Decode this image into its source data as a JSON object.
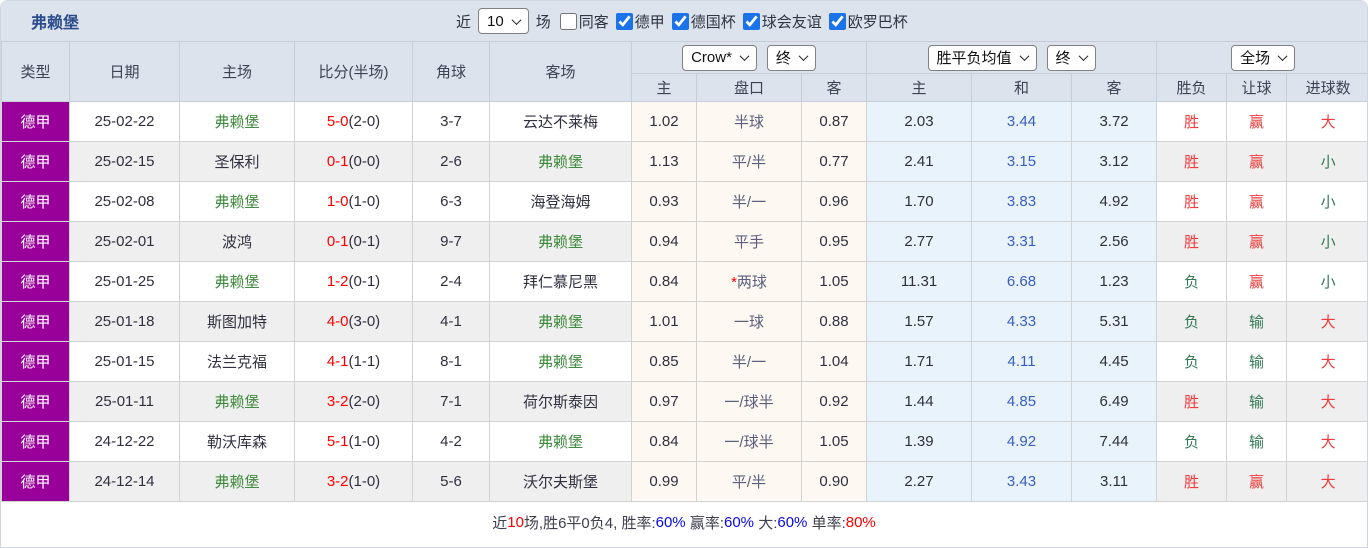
{
  "colors": {
    "league_purple": "#990099",
    "self_team_green": "#3e8a3e",
    "score_red": "#ff0000",
    "result_red": "#ef3b3b",
    "result_green": "#337a55",
    "avg_draw_blue": "#3a5dc0",
    "checkbox_blue": "#1a73e8",
    "header_bg": "#dce3ed"
  },
  "header": {
    "title": "弗赖堡",
    "near_label": "近",
    "near_value": "10",
    "games_label": "场",
    "filters": [
      {
        "label": "同客",
        "checked": false
      },
      {
        "label": "德甲",
        "checked": true
      },
      {
        "label": "德国杯",
        "checked": true
      },
      {
        "label": "球会友谊",
        "checked": true
      },
      {
        "label": "欧罗巴杯",
        "checked": true
      }
    ]
  },
  "table": {
    "columns": {
      "type": "类型",
      "date": "日期",
      "home": "主场",
      "score": "比分(半场)",
      "corners": "角球",
      "away": "客场",
      "odds_home": "主",
      "odds_handicap": "盘口",
      "odds_away": "客",
      "avg_home": "主",
      "avg_draw": "和",
      "avg_away": "客",
      "result_wdl": "胜负",
      "result_handicap": "让球",
      "result_goals": "进球数"
    },
    "selects": {
      "bookmaker": "Crow*",
      "bookmaker_period": "终",
      "average": "胜平负均值",
      "average_period": "终",
      "scope": "全场"
    },
    "rows": [
      {
        "league": "德甲",
        "date": "25-02-22",
        "home": "弗赖堡",
        "home_self": true,
        "score": "5-0",
        "half": "(2-0)",
        "corners": "3-7",
        "away": "云达不莱梅",
        "away_self": false,
        "odds_home": "1.02",
        "handicap": "半球",
        "star": false,
        "odds_away": "0.87",
        "avg_home": "2.03",
        "avg_draw": "3.44",
        "avg_away": "3.72",
        "wdl": "胜",
        "handicap_result": "赢",
        "goals_result": "大"
      },
      {
        "league": "德甲",
        "date": "25-02-15",
        "home": "圣保利",
        "home_self": false,
        "score": "0-1",
        "half": "(0-0)",
        "corners": "2-6",
        "away": "弗赖堡",
        "away_self": true,
        "odds_home": "1.13",
        "handicap": "平/半",
        "star": false,
        "odds_away": "0.77",
        "avg_home": "2.41",
        "avg_draw": "3.15",
        "avg_away": "3.12",
        "wdl": "胜",
        "handicap_result": "赢",
        "goals_result": "小"
      },
      {
        "league": "德甲",
        "date": "25-02-08",
        "home": "弗赖堡",
        "home_self": true,
        "score": "1-0",
        "half": "(1-0)",
        "corners": "6-3",
        "away": "海登海姆",
        "away_self": false,
        "odds_home": "0.93",
        "handicap": "半/一",
        "star": false,
        "odds_away": "0.96",
        "avg_home": "1.70",
        "avg_draw": "3.83",
        "avg_away": "4.92",
        "wdl": "胜",
        "handicap_result": "赢",
        "goals_result": "小"
      },
      {
        "league": "德甲",
        "date": "25-02-01",
        "home": "波鸿",
        "home_self": false,
        "score": "0-1",
        "half": "(0-1)",
        "corners": "9-7",
        "away": "弗赖堡",
        "away_self": true,
        "odds_home": "0.94",
        "handicap": "平手",
        "star": false,
        "odds_away": "0.95",
        "avg_home": "2.77",
        "avg_draw": "3.31",
        "avg_away": "2.56",
        "wdl": "胜",
        "handicap_result": "赢",
        "goals_result": "小"
      },
      {
        "league": "德甲",
        "date": "25-01-25",
        "home": "弗赖堡",
        "home_self": true,
        "score": "1-2",
        "half": "(0-1)",
        "corners": "2-4",
        "away": "拜仁慕尼黑",
        "away_self": false,
        "odds_home": "0.84",
        "handicap": "两球",
        "star": true,
        "odds_away": "1.05",
        "avg_home": "11.31",
        "avg_draw": "6.68",
        "avg_away": "1.23",
        "wdl": "负",
        "handicap_result": "赢",
        "goals_result": "小"
      },
      {
        "league": "德甲",
        "date": "25-01-18",
        "home": "斯图加特",
        "home_self": false,
        "score": "4-0",
        "half": "(3-0)",
        "corners": "4-1",
        "away": "弗赖堡",
        "away_self": true,
        "odds_home": "1.01",
        "handicap": "一球",
        "star": false,
        "odds_away": "0.88",
        "avg_home": "1.57",
        "avg_draw": "4.33",
        "avg_away": "5.31",
        "wdl": "负",
        "handicap_result": "输",
        "goals_result": "大"
      },
      {
        "league": "德甲",
        "date": "25-01-15",
        "home": "法兰克福",
        "home_self": false,
        "score": "4-1",
        "half": "(1-1)",
        "corners": "8-1",
        "away": "弗赖堡",
        "away_self": true,
        "odds_home": "0.85",
        "handicap": "半/一",
        "star": false,
        "odds_away": "1.04",
        "avg_home": "1.71",
        "avg_draw": "4.11",
        "avg_away": "4.45",
        "wdl": "负",
        "handicap_result": "输",
        "goals_result": "大"
      },
      {
        "league": "德甲",
        "date": "25-01-11",
        "home": "弗赖堡",
        "home_self": true,
        "score": "3-2",
        "half": "(2-0)",
        "corners": "7-1",
        "away": "荷尔斯泰因",
        "away_self": false,
        "odds_home": "0.97",
        "handicap": "一/球半",
        "star": false,
        "odds_away": "0.92",
        "avg_home": "1.44",
        "avg_draw": "4.85",
        "avg_away": "6.49",
        "wdl": "胜",
        "handicap_result": "输",
        "goals_result": "大"
      },
      {
        "league": "德甲",
        "date": "24-12-22",
        "home": "勒沃库森",
        "home_self": false,
        "score": "5-1",
        "half": "(1-0)",
        "corners": "4-2",
        "away": "弗赖堡",
        "away_self": true,
        "odds_home": "0.84",
        "handicap": "一/球半",
        "star": false,
        "odds_away": "1.05",
        "avg_home": "1.39",
        "avg_draw": "4.92",
        "avg_away": "7.44",
        "wdl": "负",
        "handicap_result": "输",
        "goals_result": "大"
      },
      {
        "league": "德甲",
        "date": "24-12-14",
        "home": "弗赖堡",
        "home_self": true,
        "score": "3-2",
        "half": "(1-0)",
        "corners": "5-6",
        "away": "沃尔夫斯堡",
        "away_self": false,
        "odds_home": "0.99",
        "handicap": "平/半",
        "star": false,
        "odds_away": "0.90",
        "avg_home": "2.27",
        "avg_draw": "3.43",
        "avg_away": "3.11",
        "wdl": "胜",
        "handicap_result": "赢",
        "goals_result": "大"
      }
    ]
  },
  "footer": {
    "segments": [
      {
        "text": "近",
        "color": "dark"
      },
      {
        "text": "10",
        "color": "red"
      },
      {
        "text": "场,胜6平0负4, 胜率:",
        "color": "dark"
      },
      {
        "text": "60%",
        "color": "blue"
      },
      {
        "text": " 赢率:",
        "color": "dark"
      },
      {
        "text": "60%",
        "color": "blue"
      },
      {
        "text": " 大:",
        "color": "dark"
      },
      {
        "text": "60%",
        "color": "blue"
      },
      {
        "text": " 单率:",
        "color": "dark"
      },
      {
        "text": "80%",
        "color": "red"
      }
    ]
  }
}
